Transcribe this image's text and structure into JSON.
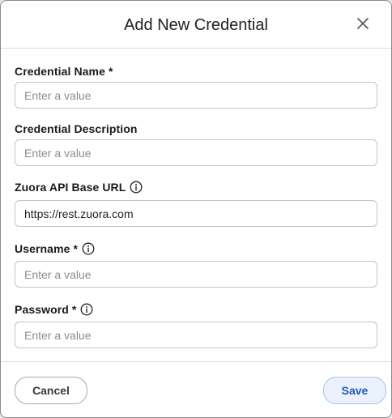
{
  "dialog": {
    "title": "Add New Credential",
    "close_icon": "close-icon"
  },
  "fields": [
    {
      "label": "Credential Name *",
      "placeholder": "Enter a value",
      "value": "",
      "info_icon": false
    },
    {
      "label": "Credential Description",
      "placeholder": "Enter a value",
      "value": "",
      "info_icon": false
    },
    {
      "label": "Zuora API Base URL",
      "placeholder": "",
      "value": "https://rest.zuora.com",
      "info_icon": true
    },
    {
      "label": "Username *",
      "placeholder": "Enter a value",
      "value": "",
      "info_icon": true
    },
    {
      "label": "Password *",
      "placeholder": "Enter a value",
      "value": "",
      "info_icon": true
    }
  ],
  "footer": {
    "cancel_label": "Cancel",
    "save_label": "Save"
  },
  "colors": {
    "save_text": "#2257b5",
    "save_background": "#eaf1fb",
    "save_border": "#aac4ea",
    "input_border": "#c4c4c4",
    "placeholder": "#8c8c8c"
  }
}
